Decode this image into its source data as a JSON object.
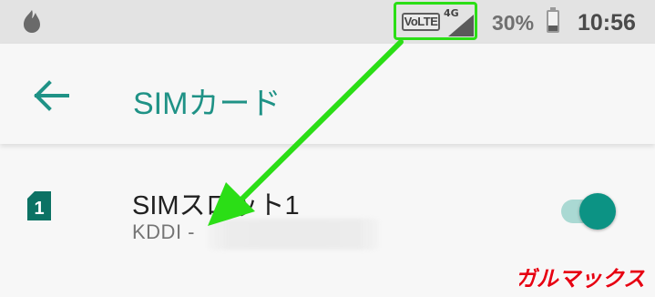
{
  "status_bar": {
    "volte_label": "VoLTE",
    "network_type": "4G",
    "battery_percent": "30%",
    "battery_level": 0.3,
    "time": "10:56",
    "icons": [
      "app-notification-icon",
      "volte-icon",
      "signal-icon",
      "battery-icon"
    ]
  },
  "toolbar": {
    "back_icon": "arrow-back-icon",
    "title": "SIMカード"
  },
  "sim_slot": {
    "slot_badge": "1",
    "title": "SIMスロット1",
    "subtitle": "KDDI - ",
    "enabled": true
  },
  "watermark": {
    "text": "ガルマックス"
  },
  "colors": {
    "accent": "#0c9384",
    "title_color": "#1f9286",
    "annotation": "#2bde16",
    "watermark": "#e60012"
  }
}
